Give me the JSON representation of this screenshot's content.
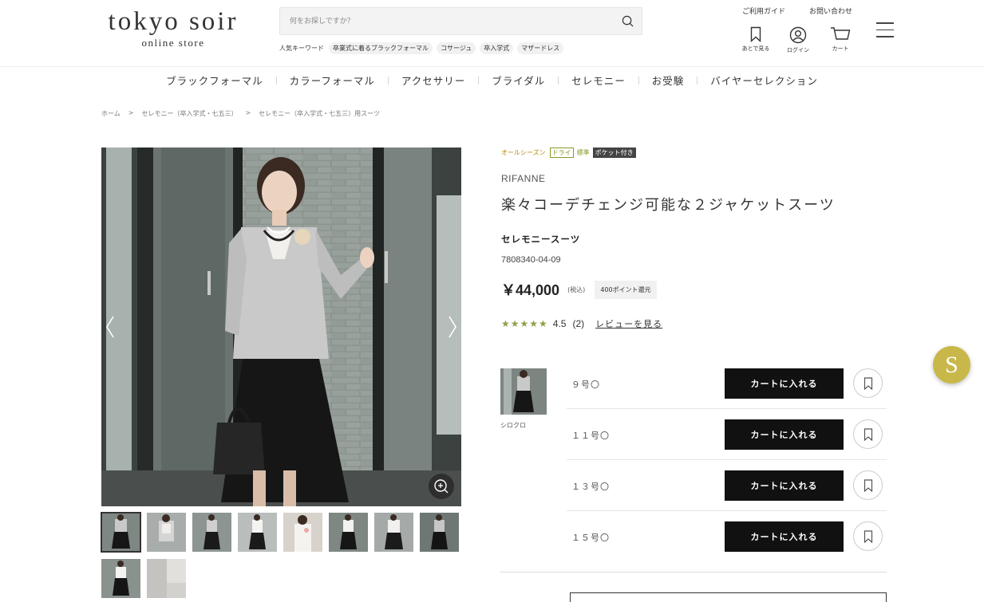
{
  "header": {
    "logo_main": "tokyo soir",
    "logo_sub": "online store",
    "search_placeholder": "何をお探しですか？",
    "keywords_label": "人気キーワード",
    "keywords": [
      "卒業式に着るブラックフォーマル",
      "コサージュ",
      "卒入学式",
      "マザードレス"
    ],
    "guide": "ご利用ガイド",
    "contact": "お問い合わせ",
    "icons": [
      {
        "name": "bookmark-icon",
        "label": "あとで見る"
      },
      {
        "name": "user-icon",
        "label": "ログイン"
      },
      {
        "name": "cart-icon",
        "label": "カート"
      }
    ]
  },
  "category_nav": [
    "ブラックフォーマル",
    "カラーフォーマル",
    "アクセサリー",
    "ブライダル",
    "セレモニー",
    "お受験",
    "バイヤーセレクション"
  ],
  "breadcrumb": [
    "ホーム",
    "セレモニー（卒入学式・七五三）",
    "セレモニー（卒入学式・七五三）用スーツ"
  ],
  "breadcrumb_separator": ">",
  "product": {
    "tags": {
      "season": "オールシーズン",
      "dry": "ドライ",
      "standard": "標準",
      "pocket": "ポケット付き"
    },
    "brand": "RIFANNE",
    "name": "楽々コーデチェンジ可能な２ジャケットスーツ",
    "type": "セレモニースーツ",
    "code": "7808340-04-09",
    "price": "￥44,000",
    "tax": "(税込)",
    "points": "400ポイント還元",
    "rating_stars": "★★★★★",
    "rating": "4.5",
    "review_count": "(2)",
    "review_link": "レビューを見る",
    "rating_value": 4.5
  },
  "variant": {
    "name": "シロクロ"
  },
  "sizes": [
    {
      "label": "９号〇",
      "cart": "カートに入れる"
    },
    {
      "label": "１１号〇",
      "cart": "カートに入れる"
    },
    {
      "label": "１３号〇",
      "cart": "カートに入れる"
    },
    {
      "label": "１５号〇",
      "cart": "カートに入れる"
    }
  ],
  "float_button": "S",
  "thumbnail_count": 10
}
